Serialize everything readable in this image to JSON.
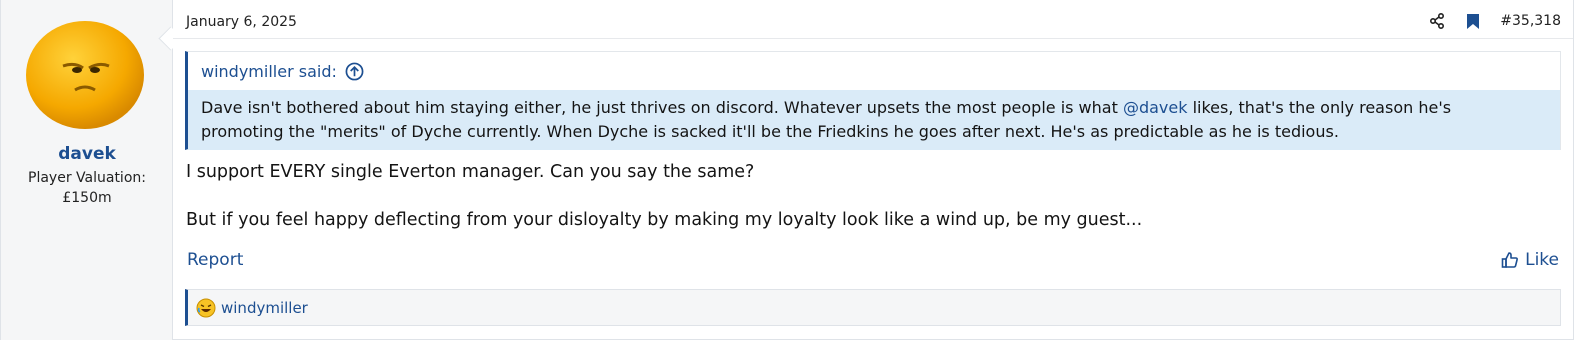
{
  "user": {
    "name": "davek",
    "valuation_label": "Player Valuation:",
    "valuation_value": "£150m"
  },
  "post": {
    "date": "January 6, 2025",
    "number": "#35,318",
    "quote": {
      "author_said": "windymiller said:",
      "text_before": "Dave isn't bothered about him staying either, he just thrives on discord. Whatever upsets the most people is what ",
      "mention": "@davek",
      "text_after_line1": " likes, that's the only reason he's",
      "line2": "promoting the \"merits\" of Dyche currently. When Dyche is sacked it'll be the Friedkins he goes after next. He's as predictable as he is tedious."
    },
    "body": [
      "I support EVERY single Everton manager. Can you say the same?",
      "But if you feel happy deflecting from your disloyalty by making my loyalty look like a wind up, be my guest..."
    ],
    "report_label": "Report",
    "like_label": "Like",
    "reaction_user": "windymiller"
  },
  "icons": {
    "share": "share-icon",
    "bookmark": "bookmark-icon",
    "goto": "arrow-up-circle-icon",
    "like": "thumbs-up-icon",
    "reaction": "laughing-emoji-icon"
  },
  "colors": {
    "link": "#1d4f91",
    "quote_bg": "#daebf8",
    "sidebar_bg": "#f5f6f7"
  }
}
